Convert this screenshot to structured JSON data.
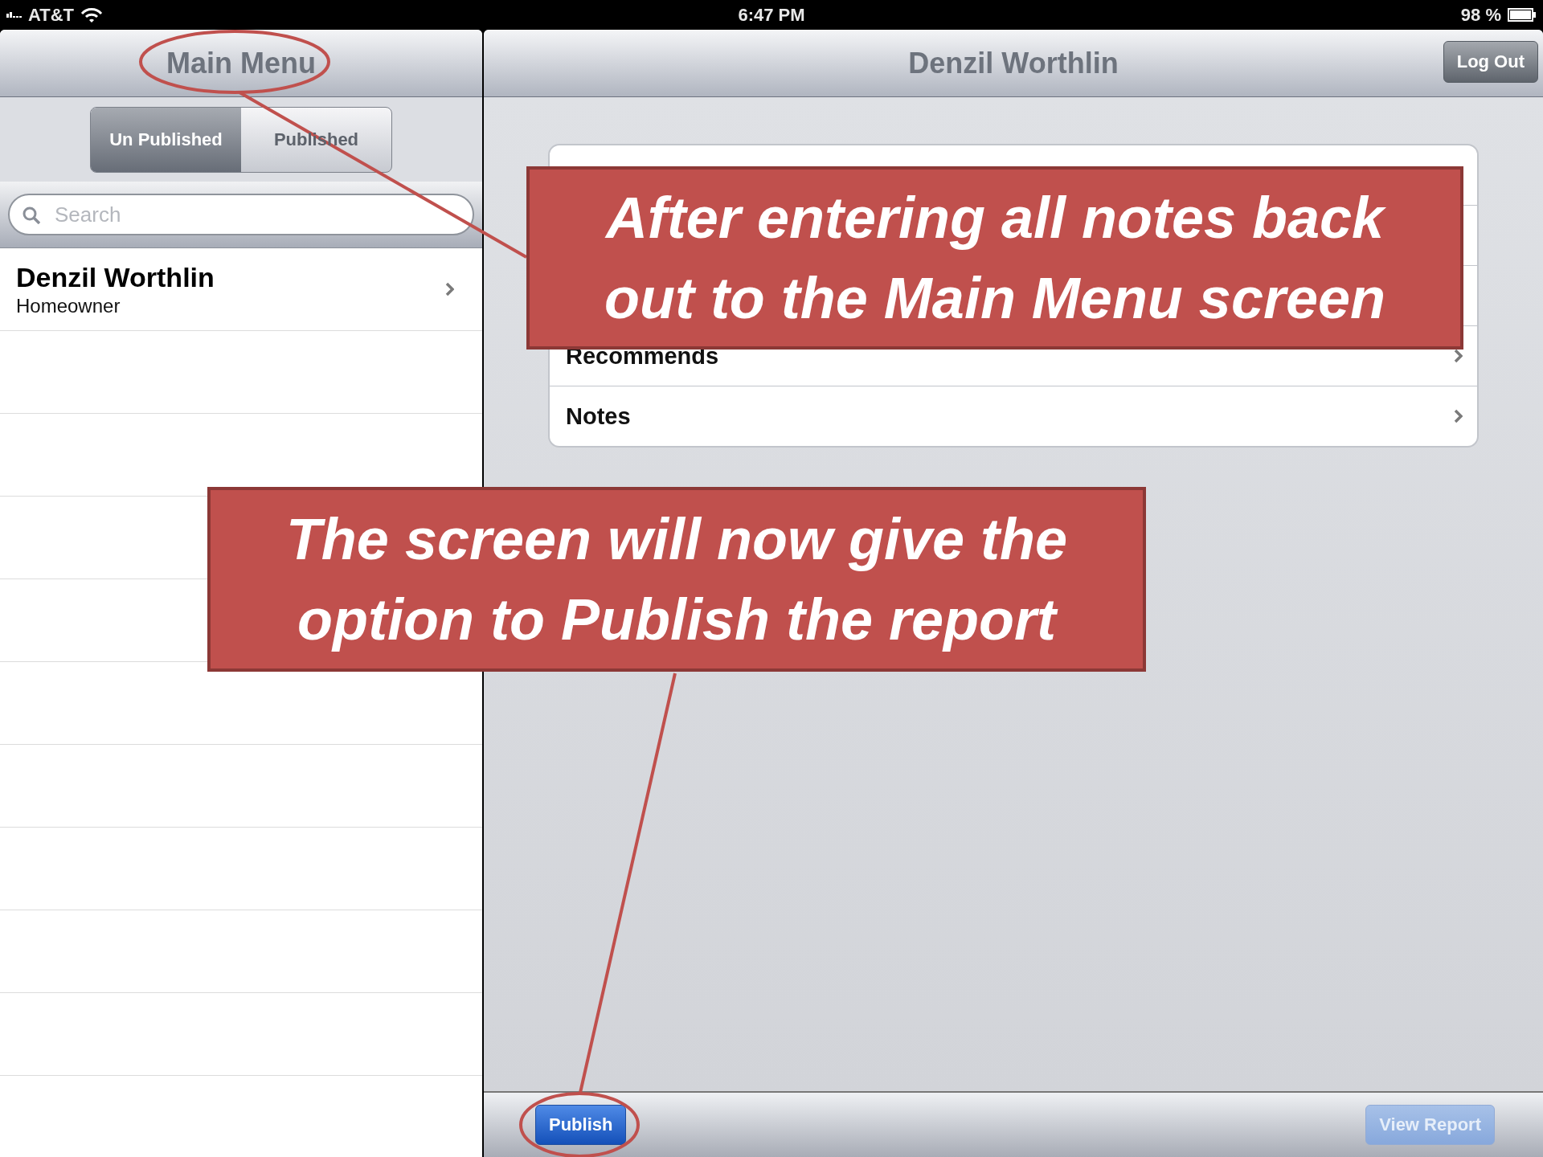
{
  "status_bar": {
    "carrier": "AT&T",
    "time": "6:47 PM",
    "battery": "98 %"
  },
  "master": {
    "title": "Main Menu",
    "segments": [
      {
        "label": "Un Published",
        "selected": true
      },
      {
        "label": "Published",
        "selected": false
      }
    ],
    "search": {
      "placeholder": "Search"
    },
    "rows": [
      {
        "title": "Denzil  Worthlin",
        "subtitle": "Homeowner"
      }
    ]
  },
  "detail": {
    "title": "Denzil  Worthlin",
    "log_out": "Log Out",
    "rows": [
      {
        "kind": "covered"
      },
      {
        "kind": "covered"
      },
      {
        "kind": "covered"
      },
      {
        "kind": "item",
        "label": "Recommends"
      },
      {
        "kind": "item",
        "label": "Notes"
      }
    ],
    "toolbar": [
      {
        "label": "Publish",
        "disabled": false
      },
      {
        "label": "View Report",
        "disabled": true
      }
    ]
  },
  "annotations": [
    {
      "text": "After entering all notes back out to the Main Menu screen"
    },
    {
      "text": "The screen will now give the option to Publish the report"
    }
  ]
}
